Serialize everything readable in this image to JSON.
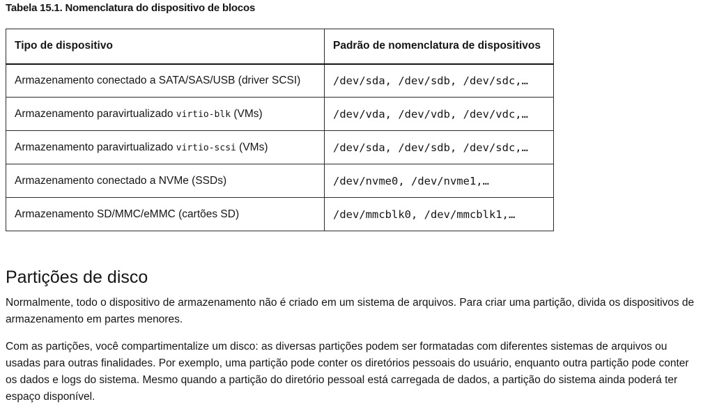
{
  "table": {
    "caption": "Tabela 15.1. Nomenclatura do dispositivo de blocos",
    "headers": [
      "Tipo de dispositivo",
      "Padrão de nomenclatura de dispositivos"
    ],
    "rows": [
      {
        "type_pre": "Armazenamento conectado a SATA/SAS/USB (driver SCSI)",
        "type_code": "",
        "type_post": "",
        "pattern": "/dev/sda, /dev/sdb, /dev/sdc,…"
      },
      {
        "type_pre": "Armazenamento paravirtualizado ",
        "type_code": "virtio-blk",
        "type_post": " (VMs)",
        "pattern": "/dev/vda, /dev/vdb, /dev/vdc,…"
      },
      {
        "type_pre": "Armazenamento paravirtualizado ",
        "type_code": "virtio-scsi",
        "type_post": " (VMs)",
        "pattern": "/dev/sda, /dev/sdb, /dev/sdc,…"
      },
      {
        "type_pre": "Armazenamento conectado a NVMe (SSDs)",
        "type_code": "",
        "type_post": "",
        "pattern": "/dev/nvme0, /dev/nvme1,…"
      },
      {
        "type_pre": "Armazenamento SD/MMC/eMMC (cartões SD)",
        "type_code": "",
        "type_post": "",
        "pattern": "/dev/mmcblk0, /dev/mmcblk1,…"
      }
    ]
  },
  "section": {
    "title": "Partições de disco",
    "paragraphs": [
      "Normalmente, todo o dispositivo de armazenamento não é criado em um sistema de arquivos. Para criar uma partição, divida os dispositivos de armazenamento em partes menores.",
      "Com as partições, você compartimentalize um disco: as diversas partições podem ser formatadas com diferentes sistemas de arquivos ou usadas para outras finalidades. Por exemplo, uma partição pode conter os diretórios pessoais do usuário, enquanto outra partição pode conter os dados e logs do sistema. Mesmo quando a partição do diretório pessoal está carregada de dados, a partição do sistema ainda poderá ter espaço disponível."
    ]
  }
}
